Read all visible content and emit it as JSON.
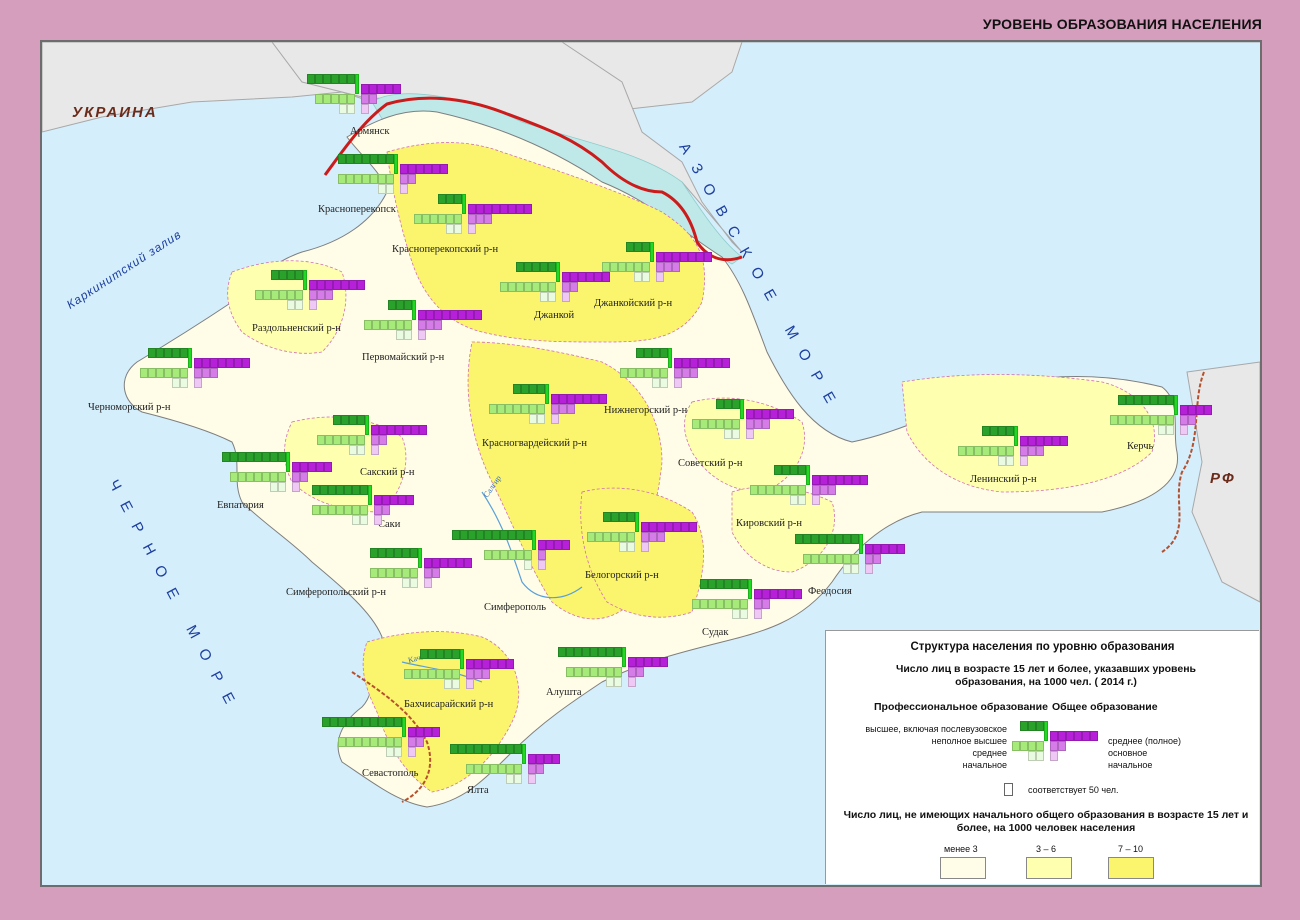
{
  "page_title": "УРОВЕНЬ ОБРАЗОВАНИЯ НАСЕЛЕНИЯ",
  "labels": {
    "ukraine": "УКРАИНА",
    "rf": "РФ",
    "karkinit": "Каркинитский залив",
    "azov_sea": "АЗОВСКОЕ МОРЕ",
    "black_sea": "ЧЕРНОЕ МОРЕ",
    "salgir": "Салгир",
    "kacha": "Кача"
  },
  "places": [
    {
      "id": "armyansk",
      "label": "Армянск"
    },
    {
      "id": "krasnoperekopsk",
      "label": "Красноперекопск"
    },
    {
      "id": "krasnoperekopsky",
      "label": "Красноперекопский р-н"
    },
    {
      "id": "dzhankoy",
      "label": "Джанкой"
    },
    {
      "id": "dzhankoysky",
      "label": "Джанкойский р-н"
    },
    {
      "id": "razdolnensky",
      "label": "Раздольненский р-н"
    },
    {
      "id": "pervomaysky",
      "label": "Первомайский р-н"
    },
    {
      "id": "chernomorsky",
      "label": "Черноморский р-н"
    },
    {
      "id": "nizhnegorsky",
      "label": "Нижнегорский р-н"
    },
    {
      "id": "krasnogvardeysky",
      "label": "Красногвардейский р-н"
    },
    {
      "id": "sovetsky",
      "label": "Советский р-н"
    },
    {
      "id": "saksky",
      "label": "Сакский р-н"
    },
    {
      "id": "evpatoria",
      "label": "Евпатория"
    },
    {
      "id": "saki",
      "label": "Саки"
    },
    {
      "id": "kirovsky",
      "label": "Кировский р-н"
    },
    {
      "id": "leninsky",
      "label": "Ленинский р-н"
    },
    {
      "id": "kerch",
      "label": "Керчь"
    },
    {
      "id": "simferopolsky",
      "label": "Симферопольский р-н"
    },
    {
      "id": "simferopol",
      "label": "Симферополь"
    },
    {
      "id": "belogorsky",
      "label": "Белогорский р-н"
    },
    {
      "id": "feodosia",
      "label": "Феодосия"
    },
    {
      "id": "sudak",
      "label": "Судак"
    },
    {
      "id": "alushta",
      "label": "Алушта"
    },
    {
      "id": "bakhchisaraysky",
      "label": "Бахчисарайский р-н"
    },
    {
      "id": "sevastopol",
      "label": "Севастополь"
    },
    {
      "id": "yalta",
      "label": "Ялта"
    }
  ],
  "legend": {
    "title": "Структура населения по уровню образования",
    "subtitle": "Число лиц  в возрасте 15 лет и более, указавших уровень образования, на 1000 чел. ( 2014 г.)",
    "prof_heading": "Профессиональное образование",
    "general_heading": "Общее образование",
    "prof_levels": [
      "высшее, включая послевузовское",
      "неполное высшее",
      "среднее",
      "начальное"
    ],
    "general_levels": [
      "среднее (полное)",
      "основное",
      "начальное"
    ],
    "unit_note": "соответствует 50 чел.",
    "no_edu_title": "Число лиц, не имеющих начального общего образования  в возрасте 15 лет и более, на 1000 человек населения",
    "classes": [
      {
        "label": "менее 3",
        "color": "#fffde8"
      },
      {
        "label": "3 – 6",
        "color": "#ffffb0"
      },
      {
        "label": "7 – 10",
        "color": "#fbf56e"
      }
    ]
  },
  "colors": {
    "higher": "#2aa12a",
    "incomplete_higher": "#22d822",
    "secondary_prof": "#a6ea7a",
    "primary_prof": "#e9fbe0",
    "secondary_full": "#b620d8",
    "basic": "#d57ce8",
    "primary_general": "#efc8f5",
    "border_rf": "#cc1b1b"
  },
  "chart_data": {
    "type": "table",
    "unit": "1 cell = 50 persons per 1000",
    "columns": [
      "higher",
      "incomplete_higher",
      "secondary_prof",
      "primary_prof",
      "secondary_full",
      "basic",
      "primary_general"
    ],
    "rows": [
      {
        "place": "Армянск",
        "higher": 6,
        "incomplete_higher": 1,
        "secondary_prof": 5,
        "primary_prof": 2,
        "secondary_full": 5,
        "basic": 2,
        "primary_general": 1
      },
      {
        "place": "Красноперекопск",
        "higher": 7,
        "incomplete_higher": 1,
        "secondary_prof": 7,
        "primary_prof": 2,
        "secondary_full": 6,
        "basic": 2,
        "primary_general": 1
      },
      {
        "place": "Красноперекопский р-н",
        "higher": 3,
        "incomplete_higher": 1,
        "secondary_prof": 6,
        "primary_prof": 2,
        "secondary_full": 8,
        "basic": 3,
        "primary_general": 1
      },
      {
        "place": "Джанкой",
        "higher": 5,
        "incomplete_higher": 1,
        "secondary_prof": 7,
        "primary_prof": 2,
        "secondary_full": 6,
        "basic": 2,
        "primary_general": 1
      },
      {
        "place": "Джанкойский р-н",
        "higher": 3,
        "incomplete_higher": 1,
        "secondary_prof": 6,
        "primary_prof": 2,
        "secondary_full": 7,
        "basic": 3,
        "primary_general": 1
      },
      {
        "place": "Раздольненский р-н",
        "higher": 4,
        "incomplete_higher": 1,
        "secondary_prof": 6,
        "primary_prof": 2,
        "secondary_full": 7,
        "basic": 3,
        "primary_general": 1
      },
      {
        "place": "Первомайский р-н",
        "higher": 3,
        "incomplete_higher": 1,
        "secondary_prof": 6,
        "primary_prof": 2,
        "secondary_full": 8,
        "basic": 3,
        "primary_general": 1
      },
      {
        "place": "Черноморский р-н",
        "higher": 5,
        "incomplete_higher": 1,
        "secondary_prof": 6,
        "primary_prof": 2,
        "secondary_full": 7,
        "basic": 3,
        "primary_general": 1
      },
      {
        "place": "Нижнегорский р-н",
        "higher": 4,
        "incomplete_higher": 1,
        "secondary_prof": 6,
        "primary_prof": 2,
        "secondary_full": 7,
        "basic": 3,
        "primary_general": 1
      },
      {
        "place": "Красногвардейский р-н",
        "higher": 4,
        "incomplete_higher": 1,
        "secondary_prof": 7,
        "primary_prof": 2,
        "secondary_full": 7,
        "basic": 3,
        "primary_general": 1
      },
      {
        "place": "Советский р-н",
        "higher": 3,
        "incomplete_higher": 1,
        "secondary_prof": 6,
        "primary_prof": 2,
        "secondary_full": 6,
        "basic": 3,
        "primary_general": 1
      },
      {
        "place": "Сакский р-н",
        "higher": 4,
        "incomplete_higher": 1,
        "secondary_prof": 6,
        "primary_prof": 2,
        "secondary_full": 7,
        "basic": 2,
        "primary_general": 1
      },
      {
        "place": "Евпатория",
        "higher": 8,
        "incomplete_higher": 1,
        "secondary_prof": 7,
        "primary_prof": 2,
        "secondary_full": 5,
        "basic": 2,
        "primary_general": 1
      },
      {
        "place": "Саки",
        "higher": 7,
        "incomplete_higher": 1,
        "secondary_prof": 7,
        "primary_prof": 2,
        "secondary_full": 5,
        "basic": 2,
        "primary_general": 1
      },
      {
        "place": "Кировский р-н",
        "higher": 4,
        "incomplete_higher": 1,
        "secondary_prof": 7,
        "primary_prof": 2,
        "secondary_full": 7,
        "basic": 3,
        "primary_general": 1
      },
      {
        "place": "Ленинский р-н",
        "higher": 4,
        "incomplete_higher": 1,
        "secondary_prof": 7,
        "primary_prof": 2,
        "secondary_full": 6,
        "basic": 3,
        "primary_general": 1
      },
      {
        "place": "Керчь",
        "higher": 7,
        "incomplete_higher": 1,
        "secondary_prof": 8,
        "primary_prof": 2,
        "secondary_full": 4,
        "basic": 2,
        "primary_general": 1
      },
      {
        "place": "Симферопольский р-н",
        "higher": 6,
        "incomplete_higher": 1,
        "secondary_prof": 6,
        "primary_prof": 2,
        "secondary_full": 6,
        "basic": 2,
        "primary_general": 1
      },
      {
        "place": "Симферополь",
        "higher": 10,
        "incomplete_higher": 1,
        "secondary_prof": 6,
        "primary_prof": 1,
        "secondary_full": 4,
        "basic": 1,
        "primary_general": 1
      },
      {
        "place": "Белогорский р-н",
        "higher": 4,
        "incomplete_higher": 1,
        "secondary_prof": 6,
        "primary_prof": 2,
        "secondary_full": 7,
        "basic": 3,
        "primary_general": 1
      },
      {
        "place": "Феодосия",
        "higher": 8,
        "incomplete_higher": 1,
        "secondary_prof": 7,
        "primary_prof": 2,
        "secondary_full": 5,
        "basic": 2,
        "primary_general": 1
      },
      {
        "place": "Судак",
        "higher": 6,
        "incomplete_higher": 1,
        "secondary_prof": 7,
        "primary_prof": 2,
        "secondary_full": 6,
        "basic": 2,
        "primary_general": 1
      },
      {
        "place": "Алушта",
        "higher": 8,
        "incomplete_higher": 1,
        "secondary_prof": 7,
        "primary_prof": 2,
        "secondary_full": 5,
        "basic": 2,
        "primary_general": 1
      },
      {
        "place": "Бахчисарайский р-н",
        "higher": 5,
        "incomplete_higher": 1,
        "secondary_prof": 7,
        "primary_prof": 2,
        "secondary_full": 6,
        "basic": 3,
        "primary_general": 1
      },
      {
        "place": "Севастополь",
        "higher": 10,
        "incomplete_higher": 1,
        "secondary_prof": 8,
        "primary_prof": 2,
        "secondary_full": 4,
        "basic": 2,
        "primary_general": 1
      },
      {
        "place": "Ялта",
        "higher": 9,
        "incomplete_higher": 1,
        "secondary_prof": 7,
        "primary_prof": 2,
        "secondary_full": 4,
        "basic": 2,
        "primary_general": 1
      }
    ]
  }
}
